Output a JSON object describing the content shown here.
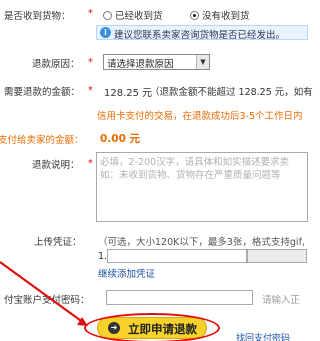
{
  "form": {
    "received": {
      "label": "是否收到货物：",
      "required_mark": "*",
      "option_yes": "已经收到货",
      "option_no": "没有收到货",
      "selected": "没有收到货",
      "notice": "建议您联系卖家咨询货物是否已经发出。"
    },
    "reason": {
      "label": "退款原因：",
      "required_mark": "*",
      "select_value": "请选择退款原因"
    },
    "amount": {
      "label": "需要退款的金额：",
      "required_mark": "*",
      "value": "128.25 元",
      "note": "（退款金额不能超过  128.25 元，如有",
      "credit_note": "信用卡支付的交易，在退款成功后3-5个工作日内"
    },
    "pay_seller": {
      "label": "支付给卖家的金额：",
      "value": "0.00 元"
    },
    "description": {
      "label": "退款说明：",
      "required_mark": "*",
      "placeholder_line1": "必填，2-200汉字，请具体和如实描述要求卖",
      "placeholder_line2": "如：未收到货物、货物存在严重质量问题等"
    },
    "evidence": {
      "label": "上传凭证：",
      "hint": "（可选，大小120K以下，最多3张，格式支持gif,",
      "index": "1.",
      "add_more": "继续添加凭证"
    },
    "password": {
      "label": "付宝账户支付密码：",
      "hint": "请输入正"
    },
    "submit_label": "立即申请退款",
    "forgot_password": "找回支付密码"
  },
  "colors": {
    "accent_orange": "#e86b00",
    "required_red": "#e60000",
    "link_blue": "#1a4fa0",
    "button_yellow": "#f7d22c",
    "annotation_red": "#e01010"
  }
}
